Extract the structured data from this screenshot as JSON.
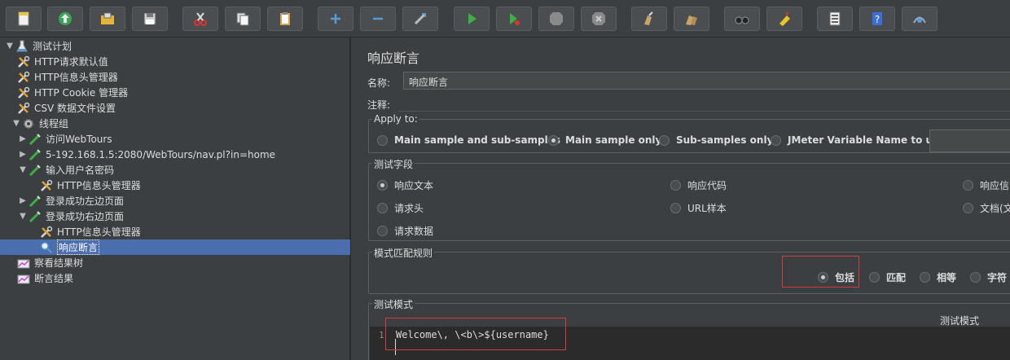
{
  "toolbar": {
    "buttons": [
      {
        "name": "new-icon"
      },
      {
        "name": "templates-icon"
      },
      {
        "name": "open-icon"
      },
      {
        "name": "save-icon"
      },
      {
        "name": "cut-icon"
      },
      {
        "name": "copy-icon"
      },
      {
        "name": "paste-icon"
      },
      {
        "name": "expand-icon"
      },
      {
        "name": "collapse-icon"
      },
      {
        "name": "toggle-icon"
      },
      {
        "name": "start-icon"
      },
      {
        "name": "start-no-pause-icon"
      },
      {
        "name": "stop-icon"
      },
      {
        "name": "shutdown-icon"
      },
      {
        "name": "clear-icon"
      },
      {
        "name": "clear-all-icon"
      },
      {
        "name": "search-icon"
      },
      {
        "name": "reset-search-icon"
      },
      {
        "name": "function-helper-icon"
      },
      {
        "name": "help-icon"
      },
      {
        "name": "remote-icon"
      }
    ]
  },
  "tree": {
    "items": [
      {
        "label": "测试计划",
        "level": 0,
        "toggle": "▼",
        "icon": "test-plan-icon"
      },
      {
        "label": "HTTP请求默认值",
        "level": 1,
        "toggle": "",
        "icon": "config-icon"
      },
      {
        "label": "HTTP信息头管理器",
        "level": 1,
        "toggle": "",
        "icon": "config-icon"
      },
      {
        "label": "HTTP Cookie 管理器",
        "level": 1,
        "toggle": "",
        "icon": "config-icon"
      },
      {
        "label": "CSV 数据文件设置",
        "level": 1,
        "toggle": "",
        "icon": "config-icon"
      },
      {
        "label": "线程组",
        "level": 1,
        "toggle": "▼",
        "icon": "thread-group-icon"
      },
      {
        "label": "访问WebTours",
        "level": 2,
        "toggle": "▶",
        "icon": "sampler-icon"
      },
      {
        "label": "5-192.168.1.5:2080/WebTours/nav.pl?in=home",
        "level": 2,
        "toggle": "▶",
        "icon": "sampler-icon"
      },
      {
        "label": "输入用户名密码",
        "level": 2,
        "toggle": "▼",
        "icon": "sampler-icon"
      },
      {
        "label": "HTTP信息头管理器",
        "level": 3,
        "toggle": "",
        "icon": "config-icon"
      },
      {
        "label": "登录成功左边页面",
        "level": 2,
        "toggle": "▶",
        "icon": "sampler-icon"
      },
      {
        "label": "登录成功右边页面",
        "level": 2,
        "toggle": "▼",
        "icon": "sampler-icon"
      },
      {
        "label": "HTTP信息头管理器",
        "level": 3,
        "toggle": "",
        "icon": "config-icon"
      },
      {
        "label": "响应断言",
        "level": 3,
        "toggle": "",
        "icon": "assertion-icon",
        "selected": true
      },
      {
        "label": "察看结果树",
        "level": 1,
        "toggle": "",
        "icon": "listener-icon"
      },
      {
        "label": "断言结果",
        "level": 1,
        "toggle": "",
        "icon": "listener-icon"
      }
    ]
  },
  "panel": {
    "title": "响应断言",
    "name_label": "名称:",
    "name_value": "响应断言",
    "comment_label": "注释:",
    "comment_value": "",
    "apply_to": {
      "title": "Apply to:",
      "options": [
        {
          "label": "Main sample and sub-samples",
          "checked": false
        },
        {
          "label": "Main sample only",
          "checked": true
        },
        {
          "label": "Sub-samples only",
          "checked": false
        },
        {
          "label": "JMeter Variable Name to use",
          "checked": false
        }
      ]
    },
    "test_field": {
      "title": "测试字段",
      "options": [
        {
          "label": "响应文本",
          "checked": true
        },
        {
          "label": "响应代码",
          "checked": false
        },
        {
          "label": "响应信",
          "checked": false
        },
        {
          "label": "请求头",
          "checked": false
        },
        {
          "label": "URL样本",
          "checked": false
        },
        {
          "label": "文档(文",
          "checked": false
        },
        {
          "label": "请求数据",
          "checked": false
        }
      ]
    },
    "pattern_rules": {
      "title": "模式匹配规则",
      "options": [
        {
          "label": "包括",
          "checked": true
        },
        {
          "label": "匹配",
          "checked": false
        },
        {
          "label": "相等",
          "checked": false
        },
        {
          "label": "字符",
          "checked": false
        }
      ]
    },
    "test_patterns": {
      "title": "测试模式",
      "column_header": "测试模式",
      "line_number": "1",
      "code": "Welcome\\, \\<b\\>${username}"
    }
  }
}
